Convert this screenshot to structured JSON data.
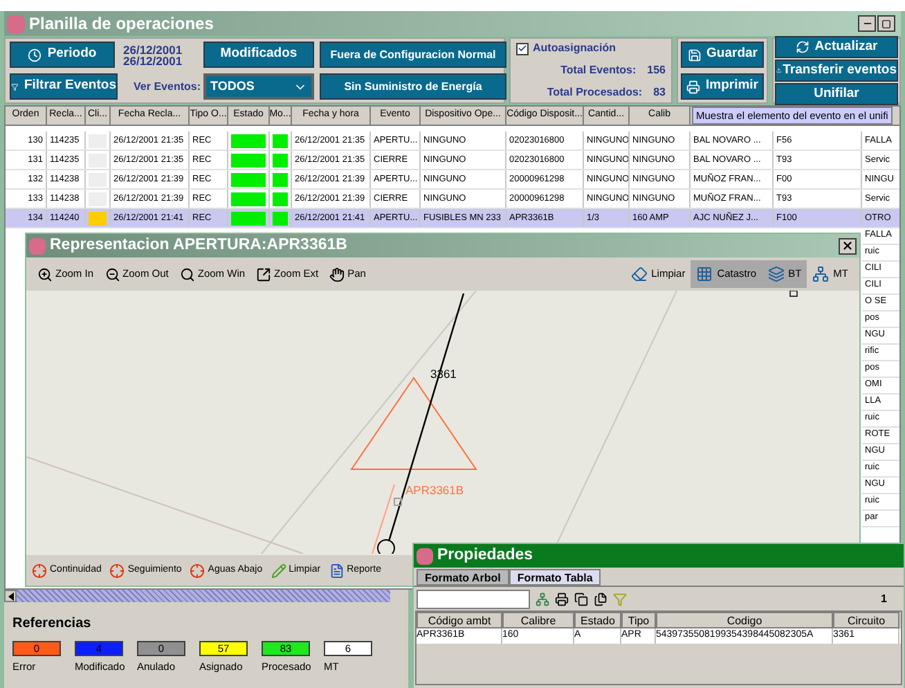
{
  "window": {
    "title": "Planilla de operaciones"
  },
  "toolbar": {
    "periodo_button": "Periodo",
    "date_from": "26/12/2001",
    "date_to": "26/12/2001",
    "filter_button": "Filtrar Eventos",
    "ver_eventos_label": "Ver Eventos:",
    "ver_eventos_value": "TODOS",
    "modificados_button": "Modificados",
    "fuera_button": "Fuera de Configuracion Normal",
    "sin_suministro_button": "Sin Suministro de Energía",
    "autoasignacion": {
      "label": "Autoasignación",
      "checked": true
    },
    "total_eventos_label": "Total Eventos:",
    "total_eventos": "156",
    "total_procesados_label": "Total Procesados:",
    "total_procesados": "83",
    "guardar_button": "Guardar",
    "imprimir_button": "Imprimir",
    "actualizar_button": "Actualizar",
    "transferir_button": "Transferir eventos",
    "unifilar_button": "Unifilar"
  },
  "tooltip": "Muestra el elemento del evento en el unifi",
  "table": {
    "columns": [
      "Orden",
      "Recla...",
      "Cli...",
      "Fecha Recla...",
      "Tipo O...",
      "Estado",
      "Mo...",
      "Fecha y hora",
      "Evento",
      "Dispositivo Ope...",
      "Código Disposit...",
      "Cantid...",
      "Calib"
    ],
    "rows": [
      {
        "selected": false,
        "orden": "130",
        "recla": "114235",
        "client": {
          "color": "#eeeeee"
        },
        "fecha_recla": "26/12/2001 21:35",
        "tipo": "REC",
        "estado": {
          "color": "#00ee00"
        },
        "mo": {
          "color": "#00ee00"
        },
        "fecha_hora": "26/12/2001 21:35",
        "evento": "APERTU...",
        "dispositivo": "NINGUNO",
        "codigo": "02023016800",
        "cantidad": "NINGUNO",
        "calibre": "NINGUNO",
        "column_14": "BAL NOVARO ...",
        "column_15": "F56",
        "column_16": "FALLA"
      },
      {
        "selected": false,
        "orden": "131",
        "recla": "114235",
        "client": {
          "color": "#eeeeee"
        },
        "fecha_recla": "26/12/2001 21:35",
        "tipo": "REC",
        "estado": {
          "color": "#00ee00"
        },
        "mo": {
          "color": "#00ee00"
        },
        "fecha_hora": "26/12/2001 21:35",
        "evento": "CIERRE",
        "dispositivo": "NINGUNO",
        "codigo": "02023016800",
        "cantidad": "NINGUNO",
        "calibre": "NINGUNO",
        "column_14": "BAL NOVARO ...",
        "column_15": "T93",
        "column_16": "Servic"
      },
      {
        "selected": false,
        "orden": "132",
        "recla": "114238",
        "client": {
          "color": "#eeeeee"
        },
        "fecha_recla": "26/12/2001 21:39",
        "tipo": "REC",
        "estado": {
          "color": "#00ee00"
        },
        "mo": {
          "color": "#00ee00"
        },
        "fecha_hora": "26/12/2001 21:39",
        "evento": "APERTU...",
        "dispositivo": "NINGUNO",
        "codigo": "20000961298",
        "cantidad": "NINGUNO",
        "calibre": "NINGUNO",
        "column_14": "MUÑOZ FRAN...",
        "column_15": "F00",
        "column_16": "NINGU"
      },
      {
        "selected": false,
        "orden": "133",
        "recla": "114238",
        "client": {
          "color": "#eeeeee"
        },
        "fecha_recla": "26/12/2001 21:39",
        "tipo": "REC",
        "estado": {
          "color": "#00ee00"
        },
        "mo": {
          "color": "#00ee00"
        },
        "fecha_hora": "26/12/2001 21:39",
        "evento": "CIERRE",
        "dispositivo": "NINGUNO",
        "codigo": "20000961298",
        "cantidad": "NINGUNO",
        "calibre": "NINGUNO",
        "column_14": "MUÑOZ FRAN...",
        "column_15": "T93",
        "column_16": "Servic"
      },
      {
        "selected": true,
        "orden": "134",
        "recla": "114240",
        "client": {
          "color": "#ffcc00"
        },
        "fecha_recla": "26/12/2001 21:41",
        "tipo": "REC",
        "estado": {
          "color": "#00ee00"
        },
        "mo": {
          "color": "#00ee00"
        },
        "fecha_hora": "26/12/2001 21:41",
        "evento": "APERTU...",
        "dispositivo": "FUSIBLES MN 233",
        "codigo": "APR3361B",
        "cantidad": "1/3",
        "calibre": "160 AMP",
        "column_14": "AJC NUÑEZ J...",
        "column_15": "F100",
        "column_16": "OTRO"
      }
    ],
    "edge_cells": [
      "FALLA",
      "ruic",
      "CILI",
      "CILI",
      "O SE",
      "pos",
      "NGU",
      "rific",
      "pos",
      "OMI",
      "LLA",
      "ruic",
      "ROTE",
      "NGU",
      "ruic",
      "NGU",
      "ruic",
      "par"
    ]
  },
  "map_window": {
    "title": "Representacion APERTURA:APR3361B",
    "tools": [
      {
        "label": "Zoom In",
        "pressed": false
      },
      {
        "label": "Zoom Out",
        "pressed": false
      },
      {
        "label": "Zoom Win",
        "pressed": false
      },
      {
        "label": "Zoom Ext",
        "pressed": false
      },
      {
        "label": "Pan",
        "pressed": false
      }
    ],
    "right_tools": [
      {
        "label": "Limpiar",
        "pressed": false
      },
      {
        "label": "Catastro",
        "pressed": true
      },
      {
        "label": "BT",
        "pressed": true
      },
      {
        "label": "MT",
        "pressed": false
      }
    ],
    "map_labels": {
      "node": "3361",
      "device": "APR3361B"
    },
    "bottom_tools": [
      "Continuidad",
      "Seguimiento",
      "Aguas Abajo",
      "Limpiar",
      "Reporte"
    ]
  },
  "properties_window": {
    "title": "Propiedades",
    "tabs": [
      {
        "label": "Formato Arbol",
        "selected": false
      },
      {
        "label": "Formato Tabla",
        "selected": true
      }
    ],
    "counter": "1",
    "columns": [
      "Código ambt",
      "Calibre",
      "Estado",
      "Tipo",
      "Codigo",
      "Circuito"
    ],
    "rows": [
      [
        "APR3361B",
        "160",
        "A",
        "APR",
        "5439735508199354398445082305A",
        "3361"
      ]
    ]
  },
  "referencias": {
    "title": "Referencias",
    "items": [
      {
        "label": "Error",
        "count": "0",
        "color": "#ff5a1a"
      },
      {
        "label": "Modificado",
        "count": "4",
        "color": "#0a1eff"
      },
      {
        "label": "Anulado",
        "count": "0",
        "color": "#909090"
      },
      {
        "label": "Asignado",
        "count": "57",
        "color": "#ffff00"
      },
      {
        "label": "Procesado",
        "count": "83",
        "color": "#1ee81e"
      },
      {
        "label": "MT",
        "count": "6",
        "color": "#ffffff"
      }
    ]
  }
}
